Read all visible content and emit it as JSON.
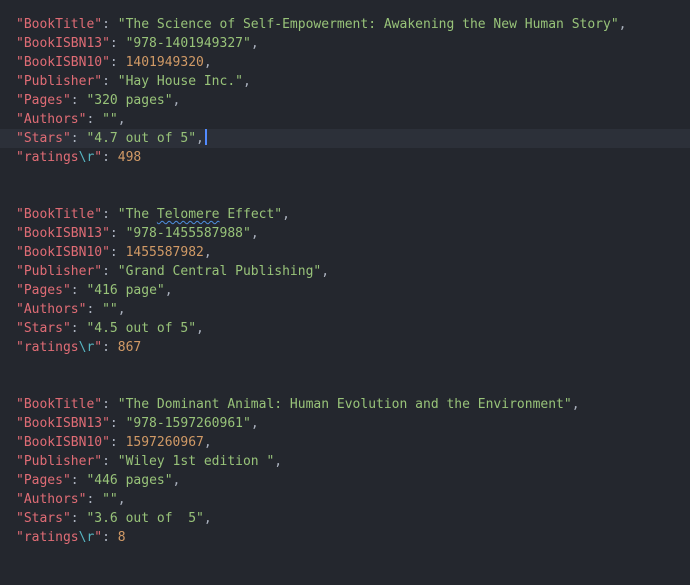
{
  "editor": {
    "records": [
      {
        "title_key": "\"BookTitle\"",
        "title_value": "\"The Science of Self-Empowerment: Awakening the New Human Story\"",
        "isbn13_key": "\"BookISBN13\"",
        "isbn13_value": "\"978-1401949327\"",
        "isbn10_key": "\"BookISBN10\"",
        "isbn10_value": "1401949320",
        "publisher_key": "\"Publisher\"",
        "publisher_value": "\"Hay House Inc.\"",
        "pages_key": "\"Pages\"",
        "pages_value": "\"320 pages\"",
        "authors_key": "\"Authors\"",
        "authors_value": "\"\"",
        "stars_key": "\"Stars\"",
        "stars_value": "\"4.7 out of 5\"",
        "ratings_key_a": "\"ratings",
        "ratings_key_esc": "\\r",
        "ratings_key_b": "\"",
        "ratings_value": "498"
      },
      {
        "title_key": "\"BookTitle\"",
        "title_value_a": "\"The ",
        "title_value_squiggle": "Telomere",
        "title_value_b": " Effect\"",
        "isbn13_key": "\"BookISBN13\"",
        "isbn13_value": "\"978-1455587988\"",
        "isbn10_key": "\"BookISBN10\"",
        "isbn10_value": "1455587982",
        "publisher_key": "\"Publisher\"",
        "publisher_value": "\"Grand Central Publishing\"",
        "pages_key": "\"Pages\"",
        "pages_value": "\"416 page\"",
        "authors_key": "\"Authors\"",
        "authors_value": "\"\"",
        "stars_key": "\"Stars\"",
        "stars_value": "\"4.5 out of 5\"",
        "ratings_key_a": "\"ratings",
        "ratings_key_esc": "\\r",
        "ratings_key_b": "\"",
        "ratings_value": "867"
      },
      {
        "title_key": "\"BookTitle\"",
        "title_value": "\"The Dominant Animal: Human Evolution and the Environment\"",
        "isbn13_key": "\"BookISBN13\"",
        "isbn13_value": "\"978-1597260961\"",
        "isbn10_key": "\"BookISBN10\"",
        "isbn10_value": "1597260967",
        "publisher_key": "\"Publisher\"",
        "publisher_value": "\"Wiley 1st edition \"",
        "pages_key": "\"Pages\"",
        "pages_value": "\"446 pages\"",
        "authors_key": "\"Authors\"",
        "authors_value": "\"\"",
        "stars_key": "\"Stars\"",
        "stars_value": "\"3.6 out of  5\"",
        "ratings_key_a": "\"ratings",
        "ratings_key_esc": "\\r",
        "ratings_key_b": "\"",
        "ratings_value": "8"
      }
    ],
    "colors": {
      "background": "#24272e",
      "active_line": "#2c3039",
      "key": "#e06c75",
      "string": "#98c379",
      "number": "#d19a66",
      "escape": "#56b6c2",
      "cursor": "#528bff"
    }
  }
}
